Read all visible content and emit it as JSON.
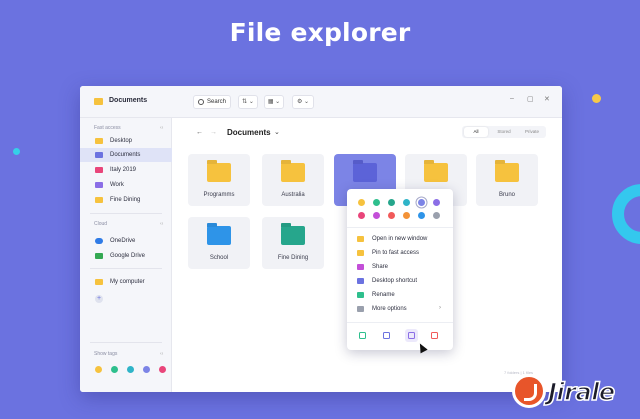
{
  "hero": {
    "title": "File explorer"
  },
  "window": {
    "title": "Documents",
    "search_label": "Search",
    "sort_button": "⇅ ⌄",
    "view_button": "▦ ⌄",
    "settings_button": "⚙ ⌄",
    "minimize": "–",
    "maximize": "▢",
    "close": "✕"
  },
  "sidebar": {
    "fast_access_label": "Fast access",
    "fast_access_collapse": "‹‹",
    "items": [
      {
        "label": "Desktop",
        "color": "#f6c23e",
        "active": false
      },
      {
        "label": "Documents",
        "color": "#6b72e0",
        "active": true
      },
      {
        "label": "Italy 2019",
        "color": "#e9457a",
        "active": false
      },
      {
        "label": "Work",
        "color": "#8b6ee6",
        "active": false
      },
      {
        "label": "Fine Dining",
        "color": "#f6c23e",
        "active": false
      }
    ],
    "cloud_label": "Cloud",
    "cloud_collapse": "‹‹",
    "cloud_items": [
      {
        "label": "OneDrive",
        "icon": "onedrive-icon",
        "color": "#2f7be6"
      },
      {
        "label": "Google Drive",
        "icon": "google-drive-icon",
        "color": "#34a853"
      }
    ],
    "computer_item": {
      "label": "My computer",
      "color": "#f6c23e"
    },
    "add_symbol": "+",
    "show_tags_label": "Show tags",
    "tags_collapse": "‹‹",
    "tags": [
      "#f6c23e",
      "#2ebf8d",
      "#2fb4c8",
      "#7c84e6",
      "#e9457a"
    ]
  },
  "toolbar": {
    "back": "←",
    "forward": "→",
    "breadcrumb": "Documents",
    "breadcrumb_chevron": "⌄",
    "filters": [
      "All",
      "Stored",
      "Private"
    ],
    "active_filter": "All"
  },
  "folders": [
    {
      "label": "Programms",
      "color": "#f6c23e",
      "selected": false
    },
    {
      "label": "Australia",
      "color": "#f6c23e",
      "selected": false
    },
    {
      "label": "",
      "color": "#5c63d8",
      "selected": true
    },
    {
      "label": "",
      "color": "#f6c23e",
      "selected": false
    },
    {
      "label": "Bruno",
      "color": "#f6c23e",
      "selected": false
    },
    {
      "label": "School",
      "color": "#2e94e8",
      "selected": false
    },
    {
      "label": "Fine Dining",
      "color": "#26a68c",
      "selected": false
    }
  ],
  "context_menu": {
    "colors_row1": [
      "#f6c23e",
      "#2ebf8d",
      "#26a68c",
      "#2fb4c8",
      "#7c84e6",
      "#8b6ee6"
    ],
    "colors_row2": [
      "#e9457a",
      "#c34fd8",
      "#f15a5a",
      "#f39237",
      "#2e94e8",
      "#9aa0ad"
    ],
    "selected_color_index": 4,
    "items": [
      {
        "label": "Open in new window",
        "icon": "folder-open-icon",
        "icon_color": "#f6c23e"
      },
      {
        "label": "Pin to fast access",
        "icon": "pin-icon",
        "icon_color": "#f6c23e"
      },
      {
        "label": "Share",
        "icon": "share-icon",
        "icon_color": "#c34fd8"
      },
      {
        "label": "Desktop shortcut",
        "icon": "desktop-icon",
        "icon_color": "#6b72e0"
      },
      {
        "label": "Rename",
        "icon": "rename-icon",
        "icon_color": "#2ebf8d"
      },
      {
        "label": "More options",
        "icon": "more-icon",
        "icon_color": "#9aa0ad",
        "arrow": "›"
      }
    ],
    "actions": [
      {
        "name": "excel-icon",
        "color": "#2ebf8d"
      },
      {
        "name": "copy-icon",
        "color": "#6b72e0"
      },
      {
        "name": "export-icon",
        "color": "#8b6ee6"
      },
      {
        "name": "trash-icon",
        "color": "#f15a5a"
      }
    ]
  },
  "status": {
    "text": "7 folders | 1 files"
  },
  "branding": {
    "word": "Jirale"
  }
}
